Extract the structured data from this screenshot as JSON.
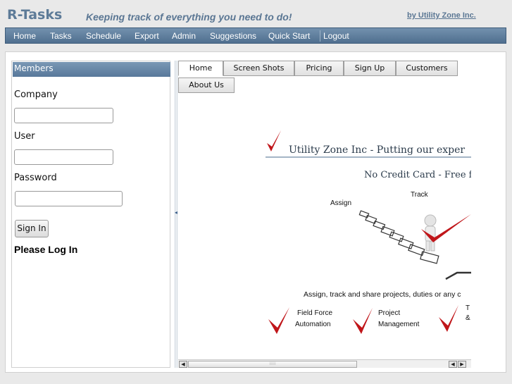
{
  "header": {
    "brand": "R-Tasks",
    "tagline": "Keeping track of everything you need to do!",
    "byline": "by Utility Zone Inc."
  },
  "nav": {
    "items": [
      "Home",
      "Tasks",
      "Schedule",
      "Export",
      "Admin",
      "Suggestions",
      "Quick Start",
      "Logout"
    ]
  },
  "members": {
    "title": "Members",
    "company_label": "Company",
    "company_value": "",
    "user_label": "User",
    "user_value": "",
    "password_label": "Password",
    "password_value": "",
    "signin_label": "Sign In",
    "status": "Please Log In"
  },
  "tabs": [
    "Home",
    "Screen Shots",
    "Pricing",
    "Sign Up",
    "Customers",
    "About Us"
  ],
  "active_tab": "Home",
  "promo": {
    "headline": "Utility Zone Inc - Putting our exper",
    "subheadline": "No Credit Card - Free fo",
    "assign": "Assign",
    "track": "Track",
    "caption": "Assign, track and share projects, duties or any c",
    "features": [
      {
        "line1": "Field Force",
        "line2": "Automation"
      },
      {
        "line1": "Project",
        "line2": "Management"
      },
      {
        "line1": "T",
        "line2": "&"
      }
    ]
  },
  "colors": {
    "nav_bar": "#5f7fa0",
    "brand_text": "#5d7b98",
    "check_red": "#c0161a"
  }
}
